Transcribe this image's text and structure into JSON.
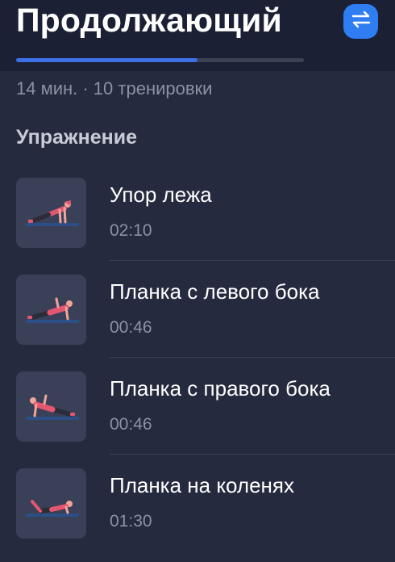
{
  "header": {
    "title": "Продолжающий",
    "switch_icon": "swap-arrows-icon",
    "progress_fraction": 0.63
  },
  "meta": {
    "text": "14 мин. · 10 тренировки"
  },
  "section": {
    "title": "Упражнение"
  },
  "colors": {
    "accent": "#2f7df3",
    "progress": "#3d6fe6",
    "background": "#252a3f",
    "header_background": "#1b2035",
    "muted_text": "#8c91a3"
  },
  "exercises": [
    {
      "name": "Упор лежа",
      "time": "02:10",
      "icon": "push-up-illustration"
    },
    {
      "name": "Планка с левого бока",
      "time": "00:46",
      "icon": "left-side-plank-illustration"
    },
    {
      "name": "Планка с правого бока",
      "time": "00:46",
      "icon": "right-side-plank-illustration"
    },
    {
      "name": "Планка на коленях",
      "time": "01:30",
      "icon": "knee-plank-illustration"
    }
  ]
}
